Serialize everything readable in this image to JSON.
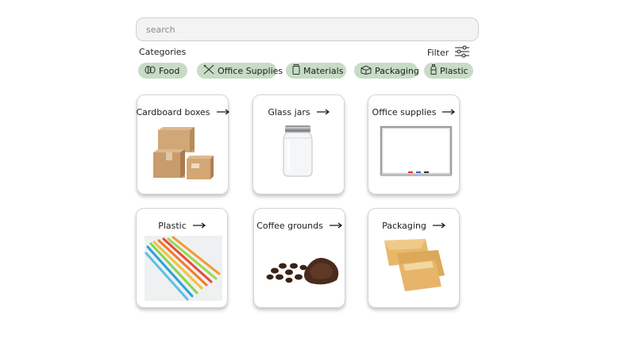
{
  "search": {
    "placeholder": "search"
  },
  "categories": {
    "title": "Categories",
    "filter_label": "Filter",
    "chips": [
      {
        "label": "Food",
        "icon": "food-icon"
      },
      {
        "label": "Office Supplies",
        "icon": "office-supplies-icon"
      },
      {
        "label": "Materials",
        "icon": "materials-icon"
      },
      {
        "label": "Packaging",
        "icon": "packaging-icon"
      },
      {
        "label": "Plastic",
        "icon": "plastic-icon"
      }
    ]
  },
  "cards": [
    {
      "title": "Cardboard boxes",
      "image": "cardboard-boxes-image"
    },
    {
      "title": "Glass jars",
      "image": "glass-jar-image"
    },
    {
      "title": "Office supplies",
      "image": "whiteboard-image"
    },
    {
      "title": "Plastic",
      "image": "plastic-straws-image"
    },
    {
      "title": "Coffee grounds",
      "image": "coffee-grounds-image"
    },
    {
      "title": "Packaging",
      "image": "padded-envelopes-image"
    }
  ],
  "colors": {
    "chip_bg": "#c7dcc5",
    "page_bg": "#ffffff"
  }
}
